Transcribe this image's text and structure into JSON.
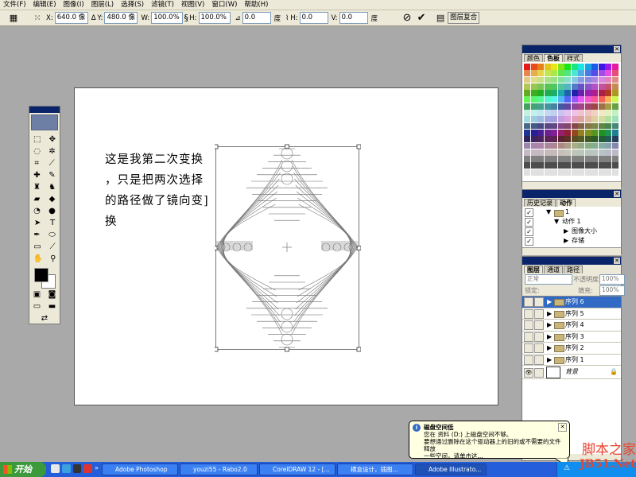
{
  "menu": [
    "文件(F)",
    "编辑(E)",
    "图像(I)",
    "图层(L)",
    "选择(S)",
    "滤镜(T)",
    "视图(V)",
    "窗口(W)",
    "帮助(H)"
  ],
  "options": {
    "x_label": "X:",
    "x_value": "640.0 像",
    "y_label": "Y:",
    "y_value": "480.0 像",
    "w_label": "W:",
    "w_value": "100.0%",
    "h_label": "H:",
    "h_value": "100.0%",
    "angle_value": "0.0",
    "angle_unit": "度",
    "hskew_label": "H:",
    "hskew_value": "0.0",
    "vskew_label": "V:",
    "vskew_value": "0.0",
    "vskew_unit": "度",
    "palette_tab": "图层复合"
  },
  "canvas": {
    "note_lines": [
      "这是我第二次变换",
      "，只是把两次选择",
      "的路径做了镜向变]",
      "换"
    ]
  },
  "swatches_palette": {
    "tabs": [
      "颜色",
      "色板",
      "样式"
    ]
  },
  "history_palette": {
    "tabs": [
      "历史记录",
      "动作"
    ],
    "rows": [
      {
        "label": "1",
        "indent": 0,
        "checked": true
      },
      {
        "label": "动作 1",
        "indent": 1,
        "checked": true
      },
      {
        "label": "图像大小",
        "indent": 2,
        "checked": true
      },
      {
        "label": "存储",
        "indent": 2,
        "checked": true
      }
    ]
  },
  "layers_palette": {
    "tabs": [
      "图层",
      "通道",
      "路径"
    ],
    "blend_mode": "正常",
    "opacity_label": "不透明度:",
    "opacity_value": "100%",
    "lock_label": "锁定:",
    "fill_label": "填充:",
    "fill_value": "100%",
    "layers": [
      {
        "name": "序列 6",
        "selected": true
      },
      {
        "name": "序列 5",
        "selected": false
      },
      {
        "name": "序列 4",
        "selected": false
      },
      {
        "name": "序列 3",
        "selected": false
      },
      {
        "name": "序列 2",
        "selected": false
      },
      {
        "name": "序列 1",
        "selected": false
      }
    ],
    "background_name": "背景"
  },
  "balloon": {
    "title": "磁盘空间低",
    "line1": "您在 资料 (D:) 上磁盘空间不够。",
    "line2": "要想通过删除在这个驱动器上的旧的或不需要的文件释放",
    "line3": "一些空间，请单击这..."
  },
  "taskbar": {
    "start_label": "开始",
    "tasks": [
      "Adobe Photoshop",
      "youzi55 - Rabo2.0",
      "CorelDRAW 12 - [...",
      "横盒设计，插图...",
      "Adobe Illustrato..."
    ]
  },
  "watermark": {
    "line1": "脚本之家",
    "line2": "JB51.Net"
  },
  "colors": {
    "accent": "#0a246a",
    "taskbar": "#245edb",
    "selection": "#316ac5",
    "watermark": "#e9432d"
  }
}
